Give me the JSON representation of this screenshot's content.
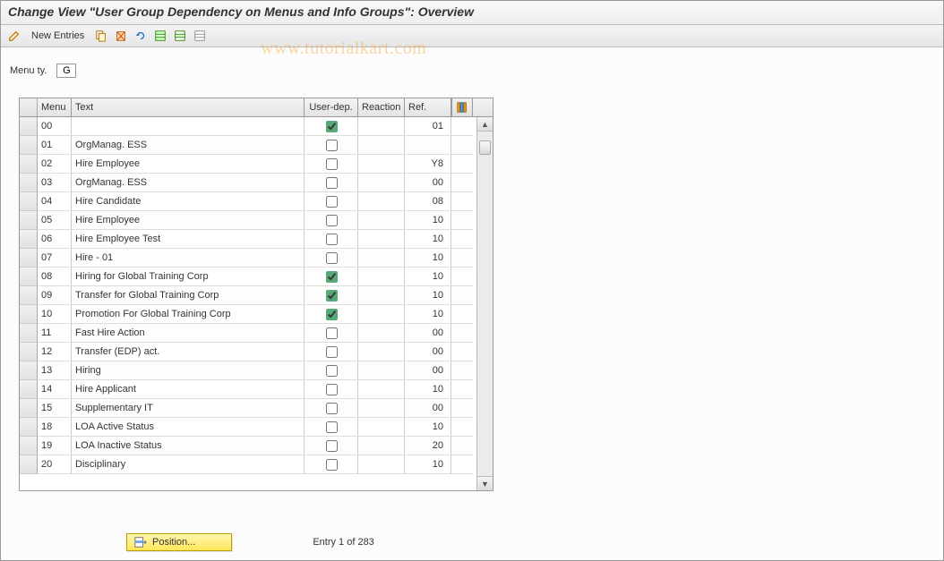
{
  "header": {
    "title": "Change View \"User Group Dependency on Menus and Info Groups\": Overview"
  },
  "toolbar": {
    "new_entries_label": "New Entries"
  },
  "watermark": "www.tutorialkart.com",
  "filter": {
    "label": "Menu ty.",
    "value": "G"
  },
  "grid": {
    "headers": {
      "menu": "Menu",
      "text": "Text",
      "userdep": "User-dep.",
      "reaction": "Reaction",
      "ref": "Ref."
    },
    "rows": [
      {
        "menu": "00",
        "text": "",
        "userdep": true,
        "reaction": "",
        "ref": "01"
      },
      {
        "menu": "01",
        "text": "OrgManag. ESS",
        "userdep": false,
        "reaction": "",
        "ref": ""
      },
      {
        "menu": "02",
        "text": "Hire Employee",
        "userdep": false,
        "reaction": "",
        "ref": "Y8"
      },
      {
        "menu": "03",
        "text": "OrgManag. ESS",
        "userdep": false,
        "reaction": "",
        "ref": "00"
      },
      {
        "menu": "04",
        "text": "Hire Candidate",
        "userdep": false,
        "reaction": "",
        "ref": "08"
      },
      {
        "menu": "05",
        "text": "Hire Employee",
        "userdep": false,
        "reaction": "",
        "ref": "10"
      },
      {
        "menu": "06",
        "text": "Hire Employee Test",
        "userdep": false,
        "reaction": "",
        "ref": "10"
      },
      {
        "menu": "07",
        "text": "Hire - 01",
        "userdep": false,
        "reaction": "",
        "ref": "10"
      },
      {
        "menu": "08",
        "text": "Hiring for Global Training Corp",
        "userdep": true,
        "reaction": "",
        "ref": "10"
      },
      {
        "menu": "09",
        "text": "Transfer for Global Training Corp",
        "userdep": true,
        "reaction": "",
        "ref": "10"
      },
      {
        "menu": "10",
        "text": "Promotion For Global Training Corp",
        "userdep": true,
        "reaction": "",
        "ref": "10"
      },
      {
        "menu": "11",
        "text": "Fast Hire Action",
        "userdep": false,
        "reaction": "",
        "ref": "00"
      },
      {
        "menu": "12",
        "text": "Transfer (EDP) act.",
        "userdep": false,
        "reaction": "",
        "ref": "00"
      },
      {
        "menu": "13",
        "text": "Hiring",
        "userdep": false,
        "reaction": "",
        "ref": "00"
      },
      {
        "menu": "14",
        "text": "Hire Applicant",
        "userdep": false,
        "reaction": "",
        "ref": "10"
      },
      {
        "menu": "15",
        "text": "Supplementary IT",
        "userdep": false,
        "reaction": "",
        "ref": "00"
      },
      {
        "menu": "18",
        "text": "LOA Active Status",
        "userdep": false,
        "reaction": "",
        "ref": "10"
      },
      {
        "menu": "19",
        "text": "LOA Inactive Status",
        "userdep": false,
        "reaction": "",
        "ref": "20"
      },
      {
        "menu": "20",
        "text": "Disciplinary",
        "userdep": false,
        "reaction": "",
        "ref": "10"
      }
    ]
  },
  "footer": {
    "position_label": "Position...",
    "entry_info": "Entry 1 of 283"
  }
}
